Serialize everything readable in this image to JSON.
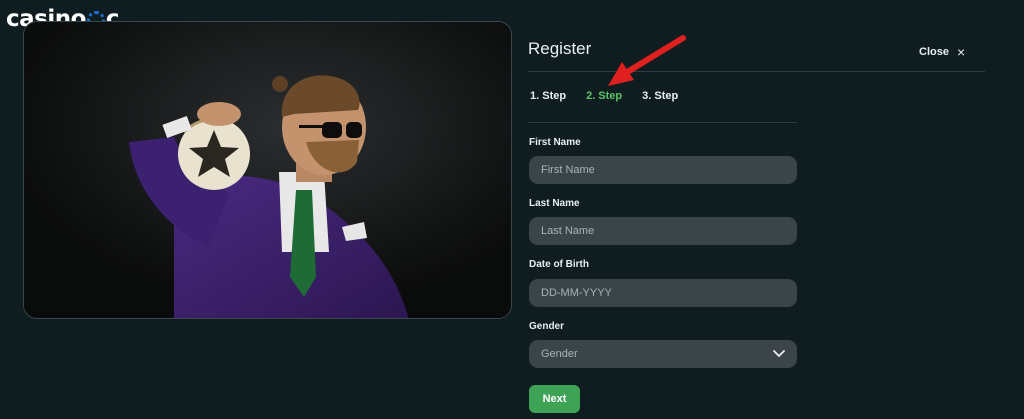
{
  "brand": {
    "logo_text_left": "casino",
    "logo_text_right": "c"
  },
  "panel": {
    "title": "Register",
    "close_label": "Close",
    "close_icon": "×"
  },
  "steps": [
    {
      "label": "1. Step",
      "active": false
    },
    {
      "label": "2. Step",
      "active": true
    },
    {
      "label": "3. Step",
      "active": false
    }
  ],
  "form": {
    "first_name": {
      "label": "First Name",
      "placeholder": "First Name"
    },
    "last_name": {
      "label": "Last Name",
      "placeholder": "Last Name"
    },
    "dob": {
      "label": "Date of Birth",
      "placeholder": "DD-MM-YYYY"
    },
    "gender": {
      "label": "Gender",
      "selected": "Gender",
      "icon": "chevron-down-icon"
    },
    "next_label": "Next"
  },
  "colors": {
    "background": "#0f1d21",
    "active_step": "#5cc36a",
    "button": "#3fa356",
    "field": "#3a4449",
    "arrow": "#e01f1f",
    "chip_blue": "#1f6fd6"
  }
}
